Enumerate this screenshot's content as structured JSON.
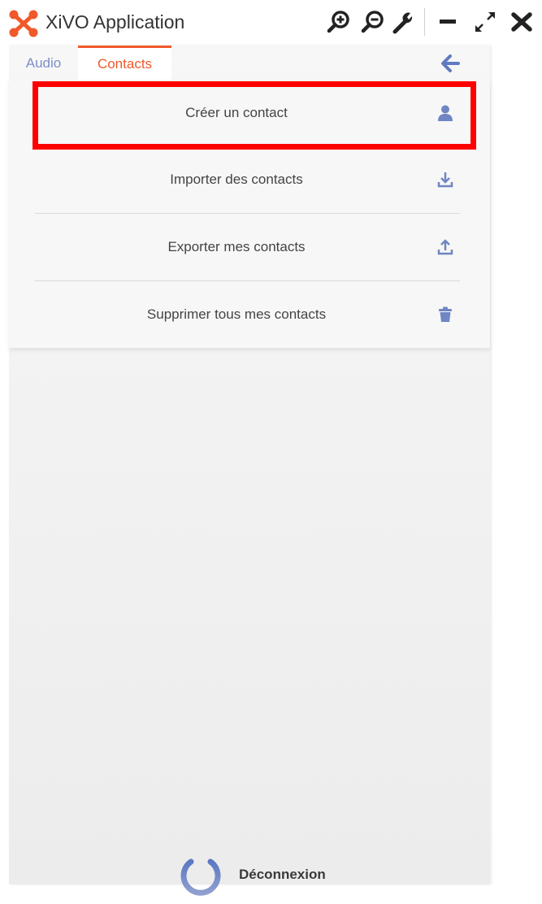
{
  "window": {
    "title": "XiVO Application",
    "brand_color": "#f0592a",
    "toolbar_icons": [
      "zoom-in-icon",
      "zoom-out-icon",
      "wrench-icon",
      "minimize-icon",
      "maximize-icon",
      "close-icon"
    ]
  },
  "tabs": [
    {
      "label": "Audio",
      "active": false
    },
    {
      "label": "Contacts",
      "active": true
    }
  ],
  "menu": {
    "items": [
      {
        "label": "Créer un contact",
        "icon": "user-icon",
        "highlighted": true
      },
      {
        "label": "Importer des contacts",
        "icon": "download-icon"
      },
      {
        "label": "Exporter mes contacts",
        "icon": "upload-icon"
      },
      {
        "label": "Supprimer tous mes contacts",
        "icon": "trash-icon"
      }
    ]
  },
  "footer": {
    "logout_label": "Déconnexion",
    "icon": "power-icon"
  },
  "colors": {
    "accent": "#f0592a",
    "icon_blue": "#6f86c2",
    "highlight": "#ff0000"
  }
}
